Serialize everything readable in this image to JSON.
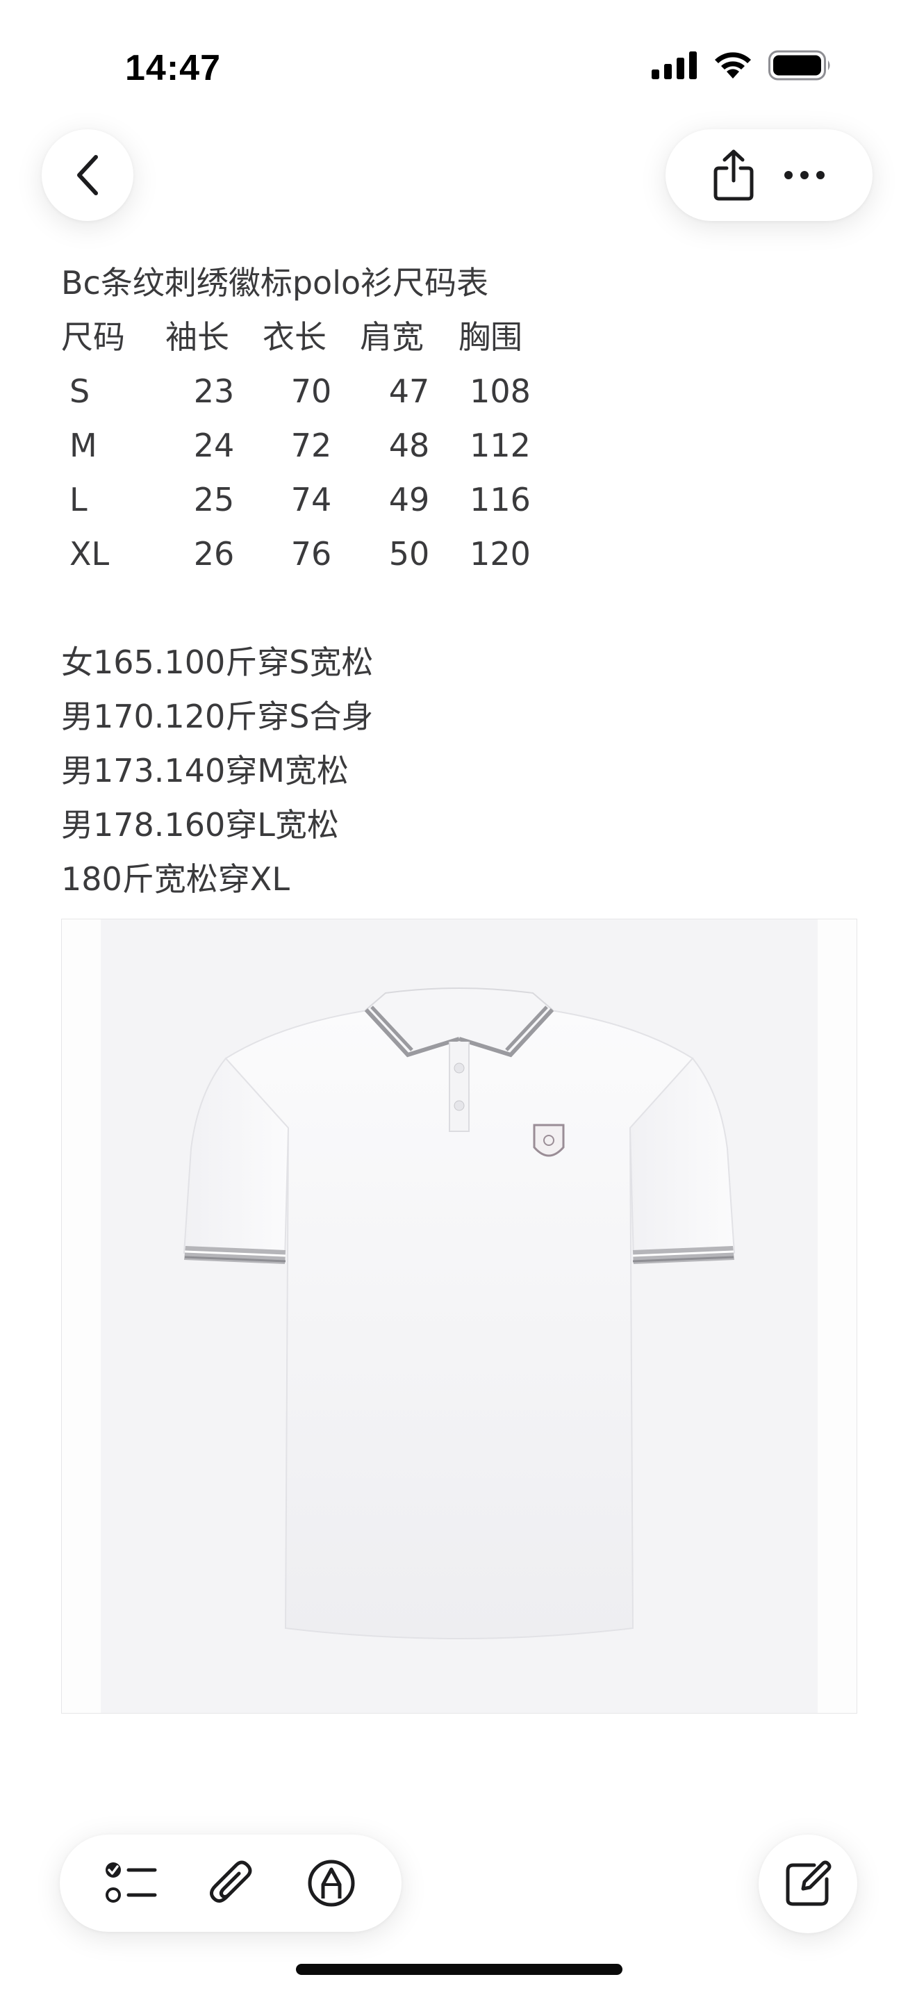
{
  "status_bar": {
    "time": "14:47",
    "icons": [
      "cellular-signal-icon",
      "wifi-icon",
      "battery-icon"
    ]
  },
  "nav": {
    "back_icon": "chevron-left-icon",
    "share_icon": "share-icon",
    "more_icon": "ellipsis-icon"
  },
  "note": {
    "title": "Bc条纹刺绣徽标polo衫尺码表",
    "size_table": {
      "headers": [
        "尺码",
        "袖长",
        "衣长",
        "肩宽",
        "胸围"
      ],
      "rows": [
        [
          "S",
          "23",
          "70",
          "47",
          "108"
        ],
        [
          "M",
          "24",
          "72",
          "48",
          "112"
        ],
        [
          "L",
          "25",
          "74",
          "49",
          "116"
        ],
        [
          "XL",
          "26",
          "76",
          "50",
          "120"
        ]
      ]
    },
    "recommendations": [
      "女165.100斤穿S宽松",
      "男170.120斤穿S合身",
      "男173.140穿M宽松",
      "男178.160穿L宽松",
      "180斤宽松穿XL"
    ]
  },
  "image": {
    "subject": "white polo shirt with grey striped collar and cuffs, embroidered shield logo"
  },
  "toolbar": {
    "checklist_icon": "checklist-icon",
    "attachment_icon": "paperclip-icon",
    "markup_icon": "pen-markup-icon",
    "compose_icon": "compose-icon"
  },
  "colors": {
    "background": "#ffffff",
    "text": "#3a3a3c",
    "icon": "#1c1c1e"
  }
}
